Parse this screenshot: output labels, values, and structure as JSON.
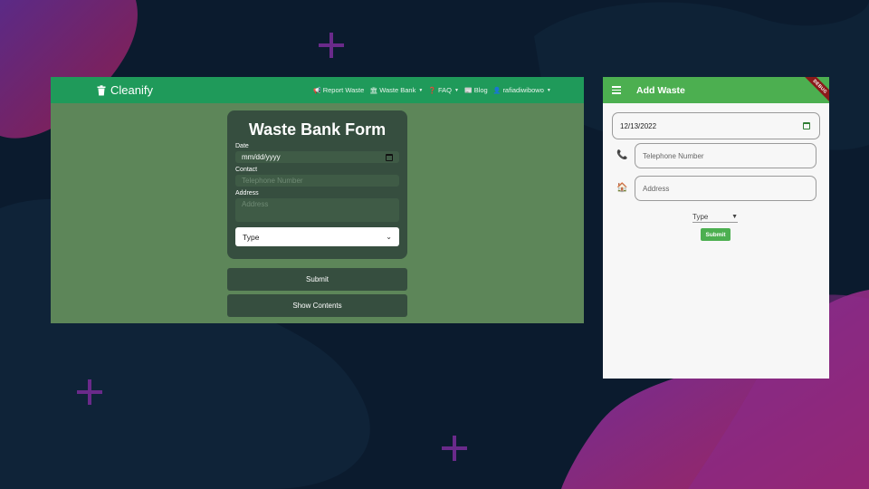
{
  "web": {
    "brand": "Cleanify",
    "nav": [
      {
        "icon": "megaphone-icon",
        "label": "Report Waste",
        "dropdown": false
      },
      {
        "icon": "bank-icon",
        "label": "Waste Bank",
        "dropdown": true
      },
      {
        "icon": "question-icon",
        "label": "FAQ",
        "dropdown": true
      },
      {
        "icon": "newspaper-icon",
        "label": "Blog",
        "dropdown": false
      },
      {
        "icon": "user-icon",
        "label": "rafiadiwibowo",
        "dropdown": true
      }
    ],
    "form": {
      "title": "Waste Bank Form",
      "date_label": "Date",
      "date_value": "mm/dd/yyyy",
      "contact_label": "Contact",
      "contact_placeholder": "Telephone Number",
      "address_label": "Address",
      "address_placeholder": "Address",
      "type_value": "Type"
    },
    "submit_label": "Submit",
    "show_contents_label": "Show Contents"
  },
  "mobile": {
    "title": "Add Waste",
    "debug_label": "DEBUG",
    "date_value": "12/13/2022",
    "telephone_placeholder": "Telephone Number",
    "address_placeholder": "Address",
    "type_value": "Type",
    "submit_label": "Submit"
  },
  "colors": {
    "web_nav": "#1f9a5a",
    "web_body": "#5d8659",
    "form_card": "#364e3f",
    "mobile_appbar": "#4caf50",
    "background": "#0b1b2e"
  }
}
